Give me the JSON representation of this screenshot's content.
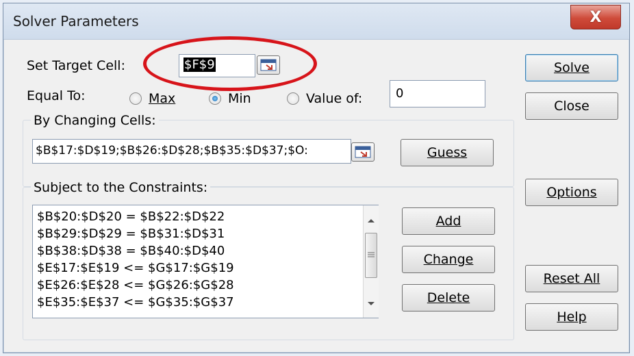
{
  "window": {
    "title": "Solver Parameters",
    "close_label": "X"
  },
  "target": {
    "label_prefix": "Set Target Cell:",
    "value": "$F$9"
  },
  "equal_to": {
    "label": "Equal To:",
    "max_label": "Max",
    "min_label": "Min",
    "value_of_label": "Value of:",
    "value_of_value": "0",
    "selected": "Min"
  },
  "changing": {
    "label": "By Changing Cells:",
    "value": "$B$17:$D$19;$B$26:$D$28;$B$35:$D$37;$O:"
  },
  "constraints": {
    "label": "Subject to the Constraints:",
    "items": [
      "$B$20:$D$20 = $B$22:$D$22",
      "$B$29:$D$29 = $B$31:$D$31",
      "$B$38:$D$38 = $B$40:$D$40",
      "$E$17:$E$19 <= $G$17:$G$19",
      "$E$26:$E$28 <= $G$26:$G$28",
      "$E$35:$E$37 <= $G$35:$G$37"
    ]
  },
  "buttons": {
    "solve": "Solve",
    "close": "Close",
    "guess": "Guess",
    "options": "Options",
    "add": "Add",
    "change": "Change",
    "delete": "Delete",
    "reset_all": "Reset All",
    "help": "Help"
  },
  "colors": {
    "annotation_circle": "#d7141a"
  }
}
